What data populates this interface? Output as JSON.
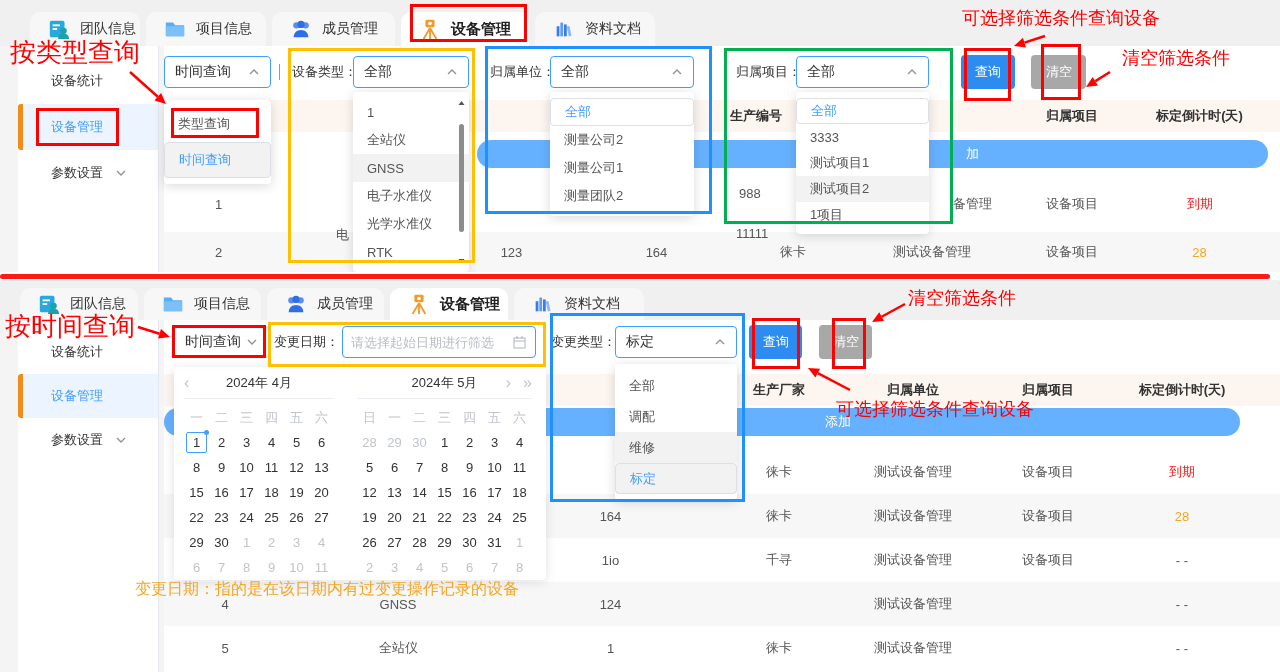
{
  "panels": [
    {
      "tabs": [
        {
          "label": "团队信息",
          "selected": false
        },
        {
          "label": "项目信息",
          "selected": false
        },
        {
          "label": "成员管理",
          "selected": false
        },
        {
          "label": "设备管理",
          "selected": true
        },
        {
          "label": "资料文档",
          "selected": false
        }
      ],
      "sidebar": {
        "items": [
          {
            "label": "设备统计",
            "kind": "link",
            "selected": false
          },
          {
            "label": "设备管理",
            "kind": "link",
            "selected": true
          },
          {
            "label": "参数设置",
            "kind": "group",
            "selected": false
          }
        ]
      },
      "query_mode": {
        "value": "时间查询",
        "open": true,
        "options": [
          {
            "label": "类型查询",
            "selected": false,
            "highlighted": false
          },
          {
            "label": "时间查询",
            "selected": true,
            "highlighted": true
          }
        ]
      },
      "filters": [
        {
          "kind": "select",
          "label": "设备类型：",
          "value": "全部",
          "open": true,
          "options": [
            {
              "label": "1",
              "selected": false,
              "highlighted": false
            },
            {
              "label": "全站仪",
              "selected": false,
              "highlighted": false
            },
            {
              "label": "GNSS",
              "selected": false,
              "highlighted": true
            },
            {
              "label": "电子水准仪",
              "selected": false,
              "highlighted": false
            },
            {
              "label": "光学水准仪",
              "selected": false,
              "highlighted": false
            },
            {
              "label": "RTK",
              "selected": false,
              "highlighted": false
            }
          ]
        },
        {
          "kind": "select",
          "label": "归属单位：",
          "value": "全部",
          "open": true,
          "options": [
            {
              "label": "全部",
              "selected": true,
              "highlighted": false
            },
            {
              "label": "测量公司2",
              "selected": false,
              "highlighted": false
            },
            {
              "label": "测量公司1",
              "selected": false,
              "highlighted": false
            },
            {
              "label": "测量团队2",
              "selected": false,
              "highlighted": false
            }
          ]
        },
        {
          "kind": "select",
          "label": "归属项目：",
          "value": "全部",
          "open": true,
          "options": [
            {
              "label": "全部",
              "selected": true,
              "highlighted": false
            },
            {
              "label": "3333",
              "selected": false,
              "highlighted": false
            },
            {
              "label": "测试项目1",
              "selected": false,
              "highlighted": false
            },
            {
              "label": "测试项目2",
              "selected": false,
              "highlighted": true
            },
            {
              "label": "1项目",
              "selected": false,
              "highlighted": false
            }
          ]
        }
      ],
      "buttons": [
        {
          "label": "查询",
          "kind": "primary"
        },
        {
          "label": "清空",
          "kind": "secondary"
        }
      ],
      "table": {
        "columns": {
          "column_5": "生产编号",
          "column_7": "归属项目",
          "column_8": "标定倒计时(天)"
        },
        "add_button": {
          "label": "加"
        },
        "rows": [
          {
            "cells": {
              "column_1": "1",
              "column_5": "988",
              "column_6": "备管理",
              "column_7": "设备项目",
              "column_8": "到期"
            },
            "color": "#ff1a1a"
          },
          {
            "cells": {
              "column_1": "2",
              "column_3": "123",
              "column_4": "164",
              "column_5": "徕卡",
              "column_6": "测试设备管理",
              "column_7": "设备项目",
              "column_8": "28"
            },
            "extra": {
              "column_2": "电",
              "column_5": "11111"
            },
            "color": "#f5a623"
          }
        ]
      },
      "annotations": [
        {
          "kind": "box",
          "color": "#ff0000"
        },
        {
          "kind": "title",
          "text": "按类型查询",
          "color": "#ff0000"
        },
        {
          "kind": "arrow",
          "color": "#ff0000"
        },
        {
          "kind": "box",
          "color": "#ff0000"
        },
        {
          "kind": "box",
          "color": "#ff0000"
        },
        {
          "kind": "box",
          "color": "#ffc000"
        },
        {
          "kind": "box",
          "color": "#1e90ff"
        },
        {
          "kind": "box",
          "color": "#00b050"
        },
        {
          "kind": "box",
          "color": "#ff0000"
        },
        {
          "kind": "box",
          "color": "#ff0000"
        },
        {
          "kind": "label",
          "text": "可选择筛选条件查询设备",
          "color": "#ff0000"
        },
        {
          "kind": "arrow",
          "color": "#ff0000"
        },
        {
          "kind": "label",
          "text": "清空筛选条件",
          "color": "#ff0000"
        },
        {
          "kind": "arrow",
          "color": "#ff0000"
        }
      ]
    },
    {
      "tabs": [
        {
          "label": "团队信息",
          "selected": false
        },
        {
          "label": "项目信息",
          "selected": false
        },
        {
          "label": "成员管理",
          "selected": false
        },
        {
          "label": "设备管理",
          "selected": true
        },
        {
          "label": "资料文档",
          "selected": false
        }
      ],
      "sidebar": {
        "items": [
          {
            "label": "设备统计",
            "kind": "link",
            "selected": false
          },
          {
            "label": "设备管理",
            "kind": "link",
            "selected": true
          },
          {
            "label": "参数设置",
            "kind": "group",
            "selected": false
          }
        ]
      },
      "query_mode": {
        "value": "时间查询",
        "open": false
      },
      "filters": [
        {
          "kind": "date",
          "label": "变更日期：",
          "placeholder": "请选择起始日期进行筛选",
          "open": true,
          "calendar": {
            "nav": {
              "prev": "‹",
              "next": "›",
              "next_year": "»"
            },
            "months": [
              {
                "title": "2024年 4月",
                "weekdays": [
                  "一",
                  "二",
                  "三",
                  "四",
                  "五",
                  "六"
                ],
                "weeks": [
                  [
                    {
                      "day": "1",
                      "muted": false,
                      "today": true
                    },
                    {
                      "day": "2",
                      "muted": false,
                      "today": false
                    },
                    {
                      "day": "3",
                      "muted": false,
                      "today": false
                    },
                    {
                      "day": "4",
                      "muted": false,
                      "today": false
                    },
                    {
                      "day": "5",
                      "muted": false,
                      "today": false
                    },
                    {
                      "day": "6",
                      "muted": false,
                      "today": false
                    }
                  ],
                  [
                    {
                      "day": "8",
                      "muted": false,
                      "today": false
                    },
                    {
                      "day": "9",
                      "muted": false,
                      "today": false
                    },
                    {
                      "day": "10",
                      "muted": false,
                      "today": false
                    },
                    {
                      "day": "11",
                      "muted": false,
                      "today": false
                    },
                    {
                      "day": "12",
                      "muted": false,
                      "today": false
                    },
                    {
                      "day": "13",
                      "muted": false,
                      "today": false
                    }
                  ],
                  [
                    {
                      "day": "15",
                      "muted": false,
                      "today": false
                    },
                    {
                      "day": "16",
                      "muted": false,
                      "today": false
                    },
                    {
                      "day": "17",
                      "muted": false,
                      "today": false
                    },
                    {
                      "day": "18",
                      "muted": false,
                      "today": false
                    },
                    {
                      "day": "19",
                      "muted": false,
                      "today": false
                    },
                    {
                      "day": "20",
                      "muted": false,
                      "today": false
                    }
                  ],
                  [
                    {
                      "day": "22",
                      "muted": false,
                      "today": false
                    },
                    {
                      "day": "23",
                      "muted": false,
                      "today": false
                    },
                    {
                      "day": "24",
                      "muted": false,
                      "today": false
                    },
                    {
                      "day": "25",
                      "muted": false,
                      "today": false
                    },
                    {
                      "day": "26",
                      "muted": false,
                      "today": false
                    },
                    {
                      "day": "27",
                      "muted": false,
                      "today": false
                    }
                  ],
                  [
                    {
                      "day": "29",
                      "muted": false,
                      "today": false
                    },
                    {
                      "day": "30",
                      "muted": false,
                      "today": false
                    },
                    {
                      "day": "1",
                      "muted": true,
                      "today": false
                    },
                    {
                      "day": "2",
                      "muted": true,
                      "today": false
                    },
                    {
                      "day": "3",
                      "muted": true,
                      "today": false
                    },
                    {
                      "day": "4",
                      "muted": true,
                      "today": false
                    }
                  ],
                  [
                    {
                      "day": "6",
                      "muted": true,
                      "today": false
                    },
                    {
                      "day": "7",
                      "muted": true,
                      "today": false
                    },
                    {
                      "day": "8",
                      "muted": true,
                      "today": false
                    },
                    {
                      "day": "9",
                      "muted": true,
                      "today": false
                    },
                    {
                      "day": "10",
                      "muted": true,
                      "today": false
                    },
                    {
                      "day": "11",
                      "muted": true,
                      "today": false
                    }
                  ]
                ]
              },
              {
                "title": "2024年 5月",
                "weekdays": [
                  "日",
                  "一",
                  "二",
                  "三",
                  "四",
                  "五",
                  "六"
                ],
                "weeks": [
                  [
                    {
                      "day": "28",
                      "muted": true,
                      "today": false
                    },
                    {
                      "day": "29",
                      "muted": true,
                      "today": false
                    },
                    {
                      "day": "30",
                      "muted": true,
                      "today": false
                    },
                    {
                      "day": "1",
                      "muted": false,
                      "today": false
                    },
                    {
                      "day": "2",
                      "muted": false,
                      "today": false
                    },
                    {
                      "day": "3",
                      "muted": false,
                      "today": false
                    },
                    {
                      "day": "4",
                      "muted": false,
                      "today": false
                    }
                  ],
                  [
                    {
                      "day": "5",
                      "muted": false,
                      "today": false
                    },
                    {
                      "day": "6",
                      "muted": false,
                      "today": false
                    },
                    {
                      "day": "7",
                      "muted": false,
                      "today": false
                    },
                    {
                      "day": "8",
                      "muted": false,
                      "today": false
                    },
                    {
                      "day": "9",
                      "muted": false,
                      "today": false
                    },
                    {
                      "day": "10",
                      "muted": false,
                      "today": false
                    },
                    {
                      "day": "11",
                      "muted": false,
                      "today": false
                    }
                  ],
                  [
                    {
                      "day": "12",
                      "muted": false,
                      "today": false
                    },
                    {
                      "day": "13",
                      "muted": false,
                      "today": false
                    },
                    {
                      "day": "14",
                      "muted": false,
                      "today": false
                    },
                    {
                      "day": "15",
                      "muted": false,
                      "today": false
                    },
                    {
                      "day": "16",
                      "muted": false,
                      "today": false
                    },
                    {
                      "day": "17",
                      "muted": false,
                      "today": false
                    },
                    {
                      "day": "18",
                      "muted": false,
                      "today": false
                    }
                  ],
                  [
                    {
                      "day": "19",
                      "muted": false,
                      "today": false
                    },
                    {
                      "day": "20",
                      "muted": false,
                      "today": false
                    },
                    {
                      "day": "21",
                      "muted": false,
                      "today": false
                    },
                    {
                      "day": "22",
                      "muted": false,
                      "today": false
                    },
                    {
                      "day": "23",
                      "muted": false,
                      "today": false
                    },
                    {
                      "day": "24",
                      "muted": false,
                      "today": false
                    },
                    {
                      "day": "25",
                      "muted": false,
                      "today": false
                    }
                  ],
                  [
                    {
                      "day": "26",
                      "muted": false,
                      "today": false
                    },
                    {
                      "day": "27",
                      "muted": false,
                      "today": false
                    },
                    {
                      "day": "28",
                      "muted": false,
                      "today": false
                    },
                    {
                      "day": "29",
                      "muted": false,
                      "today": false
                    },
                    {
                      "day": "30",
                      "muted": false,
                      "today": false
                    },
                    {
                      "day": "31",
                      "muted": false,
                      "today": false
                    },
                    {
                      "day": "1",
                      "muted": true,
                      "today": false
                    }
                  ],
                  [
                    {
                      "day": "2",
                      "muted": true,
                      "today": false
                    },
                    {
                      "day": "3",
                      "muted": true,
                      "today": false
                    },
                    {
                      "day": "4",
                      "muted": true,
                      "today": false
                    },
                    {
                      "day": "5",
                      "muted": true,
                      "today": false
                    },
                    {
                      "day": "6",
                      "muted": true,
                      "today": false
                    },
                    {
                      "day": "7",
                      "muted": true,
                      "today": false
                    },
                    {
                      "day": "8",
                      "muted": true,
                      "today": false
                    }
                  ]
                ]
              }
            ]
          }
        },
        {
          "kind": "select",
          "label": "变更类型：",
          "value": "标定",
          "open": true,
          "options": [
            {
              "label": "全部",
              "selected": false,
              "highlighted": false
            },
            {
              "label": "调配",
              "selected": false,
              "highlighted": false
            },
            {
              "label": "维修",
              "selected": false,
              "highlighted": true
            },
            {
              "label": "标定",
              "selected": true,
              "highlighted": true
            }
          ]
        }
      ],
      "buttons": [
        {
          "label": "查询",
          "kind": "primary"
        },
        {
          "label": "清空",
          "kind": "secondary"
        }
      ],
      "table": {
        "columns": {
          "column_4": "生产厂家",
          "column_5": "归属单位",
          "column_6": "归属项目",
          "column_7": "标定倒计时(天)"
        },
        "add_button": {
          "label": "添加"
        },
        "rows": [
          {
            "cells": {
              "column_4": "徕卡",
              "column_5": "测试设备管理",
              "column_6": "设备项目",
              "column_7": "到期"
            },
            "color": "#ff1a1a"
          },
          {
            "cells": {
              "column_3": "164",
              "column_4": "徕卡",
              "column_5": "测试设备管理",
              "column_6": "设备项目",
              "column_7": "28"
            },
            "color": "#f5a623"
          },
          {
            "cells": {
              "column_3": "1io",
              "column_4": "千寻",
              "column_5": "测试设备管理",
              "column_6": "设备项目",
              "column_7": "- -"
            },
            "color": "#555555"
          },
          {
            "cells": {
              "column_1": "4",
              "column_2": "GNSS",
              "column_3": "124",
              "column_5": "测试设备管理",
              "column_7": "- -"
            },
            "color": "#555555"
          },
          {
            "cells": {
              "column_1": "5",
              "column_2": "全站仪",
              "column_3": "1",
              "column_4": "徕卡",
              "column_5": "测试设备管理",
              "column_7": "- -"
            },
            "color": "#555555"
          }
        ]
      },
      "annotations": [
        {
          "kind": "title",
          "text": "按时间查询",
          "color": "#ff0000"
        },
        {
          "kind": "arrow",
          "color": "#ff0000"
        },
        {
          "kind": "box",
          "color": "#ff0000"
        },
        {
          "kind": "box",
          "color": "#ffc000"
        },
        {
          "kind": "box",
          "color": "#1e90ff"
        },
        {
          "kind": "box",
          "color": "#ff0000"
        },
        {
          "kind": "box",
          "color": "#ff0000"
        },
        {
          "kind": "label",
          "text": "清空筛选条件",
          "color": "#ff0000"
        },
        {
          "kind": "arrow",
          "color": "#ff0000"
        },
        {
          "kind": "label",
          "text": "可选择筛选条件查询设备",
          "color": "#ff0000"
        },
        {
          "kind": "arrow",
          "color": "#ff0000"
        },
        {
          "kind": "note",
          "text": "变更日期：指的是在该日期内有过变更操作记录的设备",
          "color": "#f5a623"
        }
      ]
    }
  ]
}
